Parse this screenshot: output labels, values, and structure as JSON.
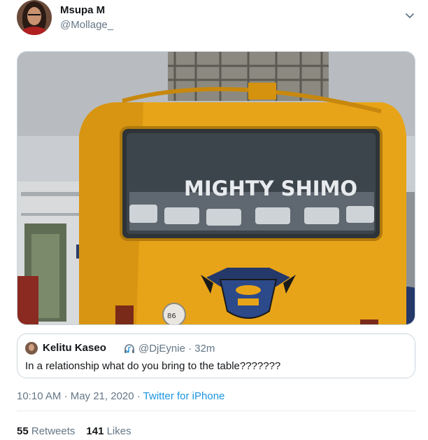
{
  "author": {
    "display_name": "Msupa M",
    "handle": "@Mollage_",
    "avatar_icon": "profile-photo"
  },
  "media": {
    "description_icon": "photo",
    "bus_window_text": "MIGHTY SHIMO",
    "plate_text": "86",
    "bus_color": "#e8a418"
  },
  "quoted_tweet": {
    "display_name": "Kelitu Kaseo",
    "badge_icon": "headphones-icon",
    "handle_time": "@DjEynie · 32m",
    "text": "In a relationship what do you bring to the table???????"
  },
  "meta": {
    "timestamp": "10:10 AM · May 21, 2020 · ",
    "source": "Twitter for iPhone"
  },
  "stats": {
    "retweets_count": "55",
    "retweets_label": " Retweets",
    "likes_count": "141",
    "likes_label": " Likes"
  },
  "colors": {
    "link": "#1b95e0",
    "secondary_text": "#657786",
    "border": "#ccd6dd"
  }
}
